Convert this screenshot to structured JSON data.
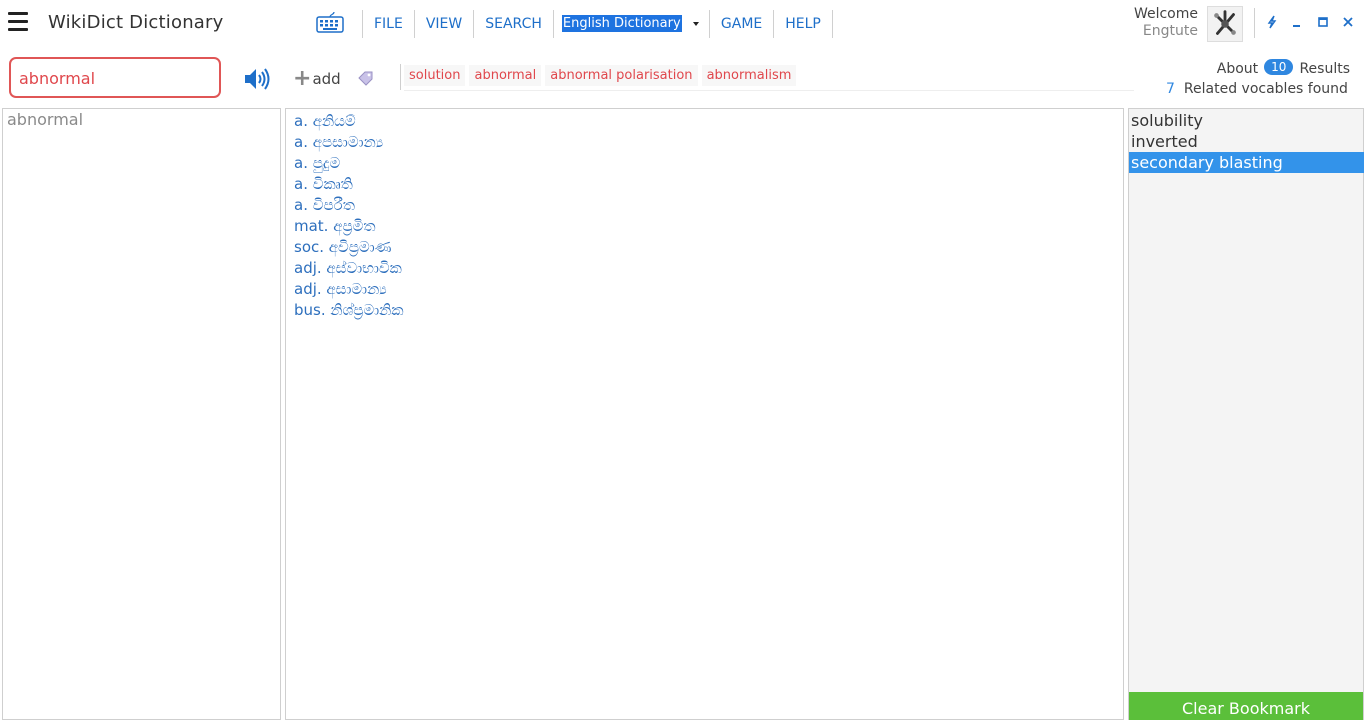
{
  "app": {
    "title": "WikiDict Dictionary"
  },
  "menu": {
    "file": "FILE",
    "view": "VIEW",
    "search": "SEARCH",
    "dictionary_selected": "English Dictionary",
    "game": "GAME",
    "help": "HELP"
  },
  "user": {
    "welcome": "Welcome",
    "name": "Engtute"
  },
  "search": {
    "value": "abnormal"
  },
  "toolbar": {
    "add_label": "add"
  },
  "suggestions": [
    "solution",
    "abnormal",
    "abnormal polarisation",
    "abnormalism"
  ],
  "results": {
    "about_label": "About",
    "count": "10",
    "results_label": "Results",
    "related_count": "7",
    "related_label": "Related vocables found"
  },
  "history": {
    "words": [
      "abnormal"
    ]
  },
  "meanings": [
    "a. අනියම්",
    "a. අපසාමාන්‍ය",
    "a. පුදුම",
    "a. විකෘති",
    "a. විපරීත",
    "mat. අප්‍රමිත",
    "soc. අවිප්‍රමාණ",
    "adj. අස්වාභාවික",
    "adj. අසාමාන්‍ය",
    "bus. නිශ්ප්‍රමානික"
  ],
  "bookmarks": {
    "items": [
      "solubility",
      "inverted",
      "secondary blasting"
    ],
    "selected_index": 2,
    "clear_label": "Clear Bookmark"
  },
  "colors": {
    "accent_blue": "#1e6fc9",
    "search_border": "#e05656",
    "selection": "#3393ea",
    "clear_button": "#5bbf3a"
  },
  "icons": [
    "hamburger-menu-icon",
    "keyboard-icon",
    "speaker-icon",
    "plus-icon",
    "tag-icon",
    "avatar-icon",
    "lightning-icon",
    "minimize-icon",
    "restore-icon",
    "close-icon"
  ]
}
